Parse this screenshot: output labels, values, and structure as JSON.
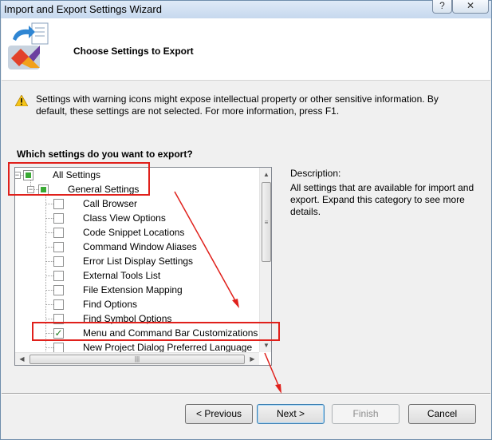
{
  "window": {
    "title": "Import and Export Settings Wizard",
    "help_label": "?",
    "close_label": "✕"
  },
  "header": {
    "title": "Choose Settings to Export"
  },
  "warning": {
    "text": "Settings with warning icons might expose intellectual property or other sensitive information. By default, these settings are not selected. For more information, press F1."
  },
  "question": "Which settings do you want to export?",
  "tree": {
    "root": {
      "label": "All Settings",
      "state": "partial"
    },
    "group": {
      "label": "General Settings",
      "state": "partial"
    },
    "items": [
      {
        "label": "Call Browser",
        "checked": false
      },
      {
        "label": "Class View Options",
        "checked": false
      },
      {
        "label": "Code Snippet Locations",
        "checked": false
      },
      {
        "label": "Command Window Aliases",
        "checked": false
      },
      {
        "label": "Error List Display Settings",
        "checked": false
      },
      {
        "label": "External Tools List",
        "checked": false
      },
      {
        "label": "File Extension Mapping",
        "checked": false
      },
      {
        "label": "Find Options",
        "checked": false
      },
      {
        "label": "Find Symbol Options",
        "checked": false
      },
      {
        "label": "Menu and Command Bar Customizations",
        "checked": true
      },
      {
        "label": "New Project Dialog Preferred Language",
        "checked": false
      }
    ]
  },
  "description": {
    "label": "Description:",
    "text": "All settings that are available for import and export. Expand this category to see more details."
  },
  "buttons": {
    "previous": "< Previous",
    "next": "Next >",
    "finish": "Finish",
    "cancel": "Cancel"
  },
  "colors": {
    "annotation": "#e0201b",
    "checkbox_fill": "#3aaa35"
  }
}
